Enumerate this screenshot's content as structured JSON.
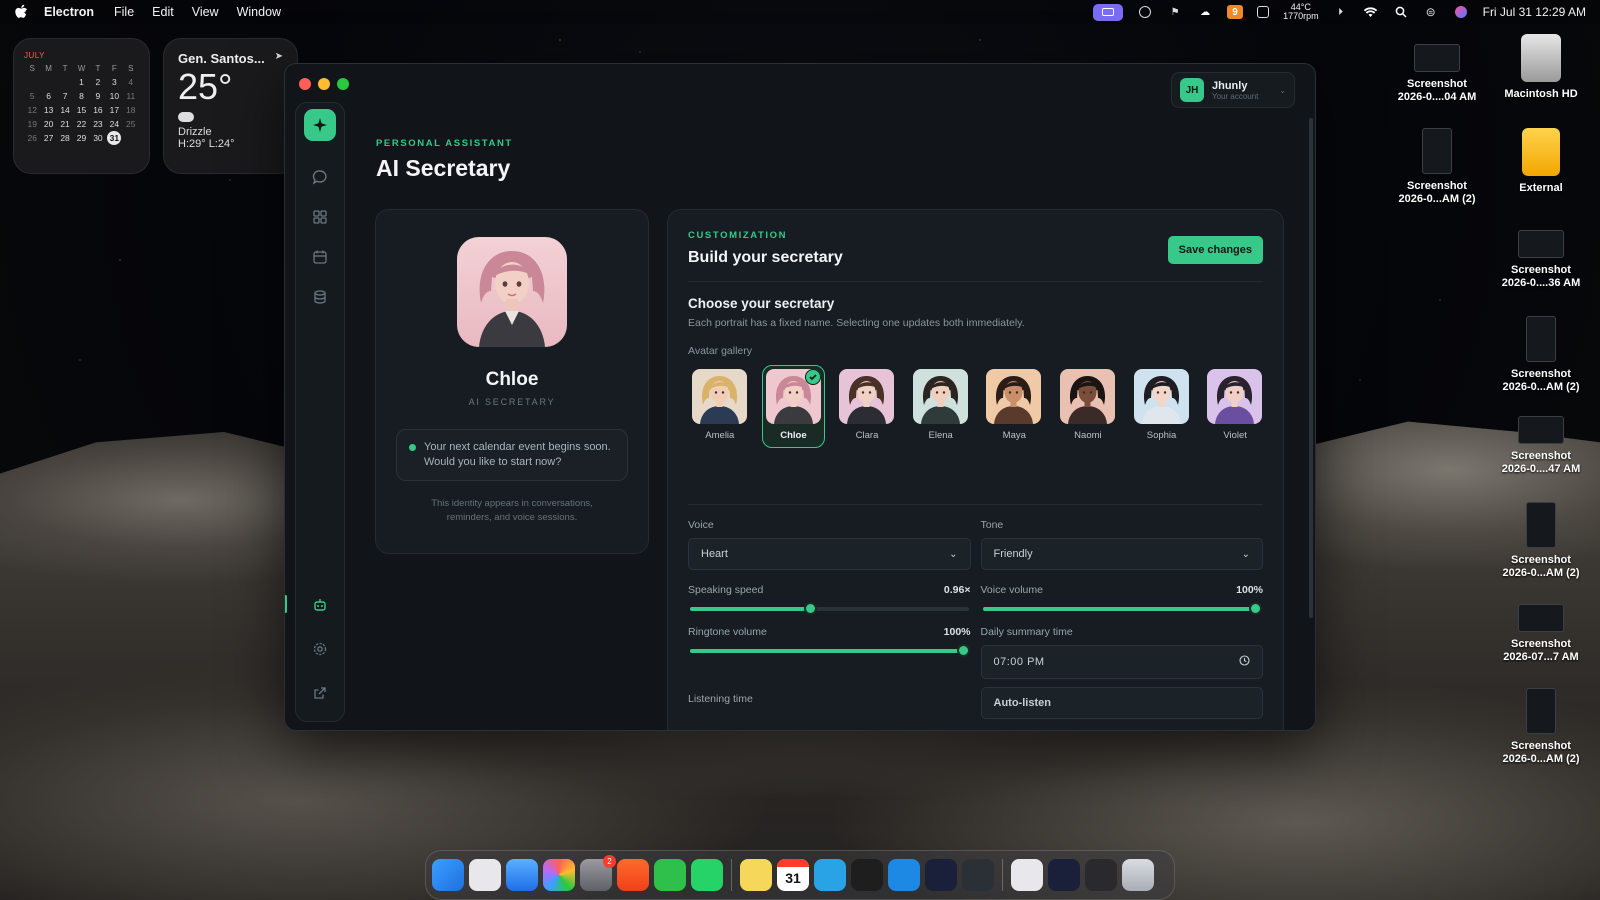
{
  "menubar": {
    "app": "Electron",
    "menus": [
      "File",
      "Edit",
      "View",
      "Window"
    ],
    "temp_top": "44°C",
    "temp_bottom": "1770rpm",
    "badge_count": "9",
    "datetime": "Fri Jul 31  12:29 AM"
  },
  "calendar_widget": {
    "month": "JULY",
    "weekdays": [
      "S",
      "M",
      "T",
      "W",
      "T",
      "F",
      "S"
    ],
    "rows": [
      [
        "",
        "",
        "",
        "1",
        "2",
        "3",
        "4"
      ],
      [
        "5",
        "6",
        "7",
        "8",
        "9",
        "10",
        "11"
      ],
      [
        "12",
        "13",
        "14",
        "15",
        "16",
        "17",
        "18"
      ],
      [
        "19",
        "20",
        "21",
        "22",
        "23",
        "24",
        "25"
      ],
      [
        "26",
        "27",
        "28",
        "29",
        "30",
        "31",
        ""
      ]
    ],
    "today": "31"
  },
  "weather_widget": {
    "city": "Gen. Santos...",
    "temp": "25°",
    "condition": "Drizzle",
    "hilo": "H:29° L:24°"
  },
  "desktop": {
    "items": [
      {
        "label1": "Screenshot",
        "label2": "2026-0....04 AM"
      },
      {
        "label1": "Macintosh HD",
        "label2": ""
      },
      {
        "label1": "Screenshot",
        "label2": "2026-0...AM (2)"
      },
      {
        "label1": "External",
        "label2": ""
      },
      {
        "label1": "Screenshot",
        "label2": "2026-0....36 AM"
      },
      {
        "label1": "Screenshot",
        "label2": "2026-0...AM (2)"
      },
      {
        "label1": "Screenshot",
        "label2": "2026-0....47 AM"
      },
      {
        "label1": "Screenshot",
        "label2": "2026-0...AM (2)"
      },
      {
        "label1": "Screenshot",
        "label2": "2026-07...7 AM"
      },
      {
        "label1": "Screenshot",
        "label2": "2026-0...AM (2)"
      }
    ]
  },
  "account": {
    "initials": "JH",
    "name": "Jhunly",
    "subtitle": "Your account"
  },
  "header": {
    "eyebrow": "PERSONAL ASSISTANT",
    "title": "AI Secretary"
  },
  "profile": {
    "name": "Chloe",
    "role": "AI SECRETARY",
    "notice": "Your next calendar event begins soon. Would you like to start now?",
    "footer": "This identity appears in conversations, reminders, and voice sessions."
  },
  "customization": {
    "eyebrow": "CUSTOMIZATION",
    "title": "Build your secretary",
    "save_label": "Save changes",
    "choose_title": "Choose your secretary",
    "choose_sub": "Each portrait has a fixed name. Selecting one updates both immediately.",
    "gallery_label": "Avatar gallery",
    "avatars": [
      {
        "name": "Amelia",
        "hair": "#d9b36a",
        "bg": "#e7d9c8",
        "skin": "#f1cdb4",
        "outfit": "#2b3a55"
      },
      {
        "name": "Chloe",
        "hair": "#c98798",
        "bg": "#efc8cf",
        "skin": "#f2d0c6",
        "outfit": "#3a3a3f"
      },
      {
        "name": "Clara",
        "hair": "#4a3126",
        "bg": "#e6c3d6",
        "skin": "#f0d1c4",
        "outfit": "#2c2c33"
      },
      {
        "name": "Elena",
        "hair": "#2c2420",
        "bg": "#cfe1dc",
        "skin": "#efcfbd",
        "outfit": "#2f3b3a"
      },
      {
        "name": "Maya",
        "hair": "#2a1c16",
        "bg": "#f0c9a6",
        "skin": "#c98f6a",
        "outfit": "#5a3a2b"
      },
      {
        "name": "Naomi",
        "hair": "#1c1412",
        "bg": "#e8c1b2",
        "skin": "#7a4e3a",
        "outfit": "#3b2a28"
      },
      {
        "name": "Sophia",
        "hair": "#1f1d22",
        "bg": "#cfe2f0",
        "skin": "#f2d6c8",
        "outfit": "#dfe6ee"
      },
      {
        "name": "Violet",
        "hair": "#2b2230",
        "bg": "#d9c3ea",
        "skin": "#f0d0c6",
        "outfit": "#6a4fa0"
      }
    ],
    "selected": "Chloe",
    "voice_label": "Voice",
    "voice_value": "Heart",
    "tone_label": "Tone",
    "tone_value": "Friendly",
    "speed_label": "Speaking speed",
    "speed_value": "0.96×",
    "speed_fraction": 0.43,
    "voice_volume_label": "Voice volume",
    "voice_volume_value": "100%",
    "voice_volume_fraction": 1.0,
    "ringtone_label": "Ringtone volume",
    "ringtone_value": "100%",
    "ringtone_fraction": 1.0,
    "summary_label": "Daily summary time",
    "summary_value": "07:00 PM",
    "listening_label": "Listening time",
    "listening_value": "Auto-listen"
  },
  "colors": {
    "accent": "#37c98a",
    "window_bg": "#111519",
    "card_bg": "#161c21"
  },
  "sidebar_icons": [
    "sparkle-icon",
    "chat-icon",
    "grid-icon",
    "calendar-icon",
    "database-icon",
    "robot-icon",
    "gear-icon",
    "external-link-icon"
  ],
  "dock_apps": [
    "Finder",
    "Launchpad",
    "Mail",
    "Photos",
    "System Settings",
    "Brave",
    "Streaks",
    "WhatsApp",
    "Notes",
    "Calendar",
    "Telegram",
    "Figma",
    "Proxyman",
    "Chat",
    "Electron",
    "Preview",
    "Screen",
    "Screen",
    "Trash"
  ],
  "dock_badge": "2",
  "calendar_dock_day": "31"
}
